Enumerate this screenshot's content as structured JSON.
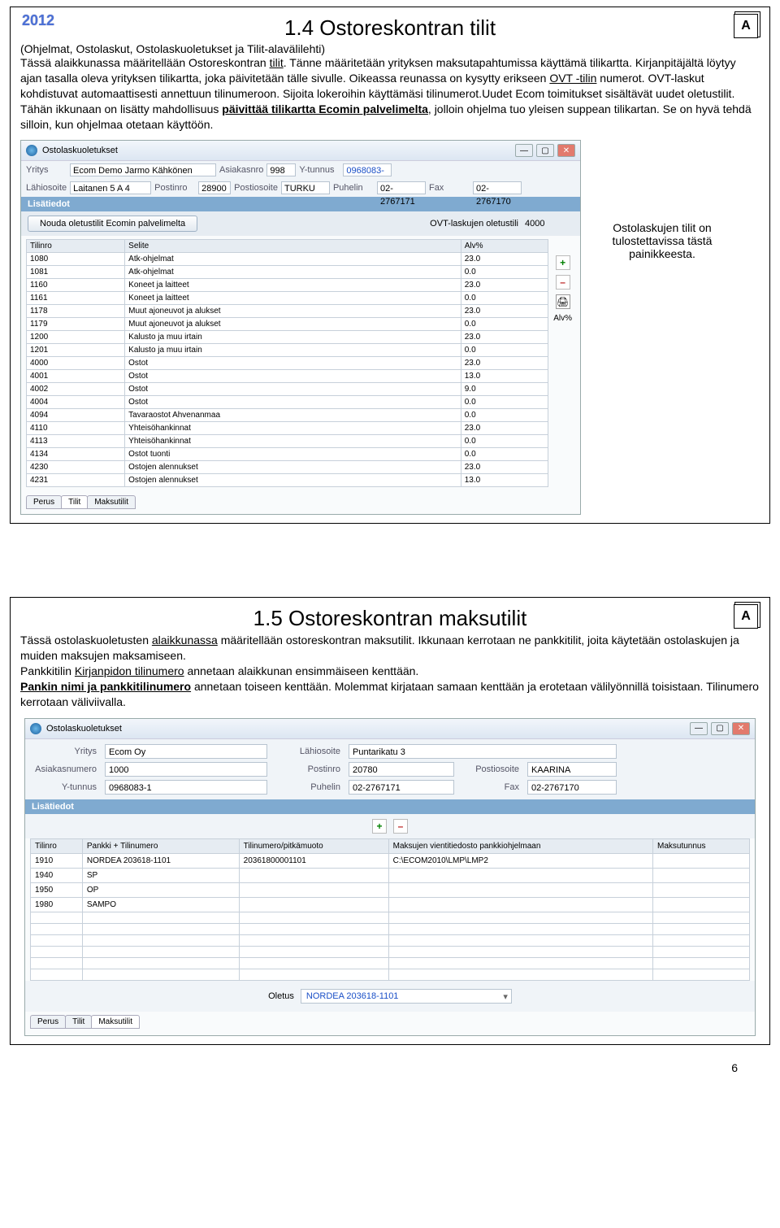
{
  "year": "2012",
  "page_number": "6",
  "section1": {
    "title": "1.4 Ostoreskontran tilit",
    "subtitle": "(Ohjelmat, Ostolaskut, Ostolaskuoletukset ja Tilit-alavälilehti)",
    "paragraph_html": "Tässä alaikkunassa määritellään Ostoreskontran <u>tilit</u>. Tänne  määritetään yrityksen maksutapahtumissa käyttämä tilikartta. Kirjanpitäjältä löytyy ajan tasalla oleva yrityksen tilikartta, joka päivitetään tälle sivulle. Oikeassa reunassa on kysytty erikseen <u>OVT -tilin</u> numerot. OVT-laskut kohdistuvat automaattisesti annettuun tilinumeroon. Sijoita lokeroihin käyttämäsi tilinumerot.Uudet Ecom toimitukset sisältävät uudet oletustilit. Tähän ikkunaan on lisätty mahdollisuus <u><b>päivittää tilikartta Ecomin palvelimelta</b></u>, jolloin ohjelma tuo yleisen suppean tilikartan. Se on hyvä tehdä silloin, kun ohjelmaa otetaan käyttöön.",
    "callout": "Ostolaskujen tilit on tulostettavissa tästä painikkeesta.",
    "window": {
      "title": "Ostolaskuoletukset",
      "row1": {
        "yritys_label": "Yritys",
        "yritys": "Ecom Demo Jarmo Kähkönen",
        "asiakasnro_label": "Asiakasnro",
        "asiakasnro": "998",
        "ytunnus_label": "Y-tunnus",
        "ytunnus": "0968083-"
      },
      "row2": {
        "lahiosoite_label": "Lähiosoite",
        "lahiosoite": "Laitanen 5 A 4",
        "postinro_label": "Postinro",
        "postinro": "28900",
        "postiosoite_label": "Postiosoite",
        "postiosoite": "TURKU",
        "puhelin_label": "Puhelin",
        "puhelin": "02-2767171",
        "fax_label": "Fax",
        "fax": "02-2767170"
      },
      "lisatiedot": "Lisätiedot",
      "btn_nouda": "Nouda oletustilit Ecomin palvelimelta",
      "ovt_label": "OVT-laskujen oletustili",
      "ovt_value": "4000",
      "headers": [
        "Tilinro",
        "Selite",
        "Alv%"
      ],
      "rows": [
        [
          "1080",
          "Atk-ohjelmat",
          "23.0"
        ],
        [
          "1081",
          "Atk-ohjelmat",
          "0.0"
        ],
        [
          "1160",
          "Koneet ja laitteet",
          "23.0"
        ],
        [
          "1161",
          "Koneet ja laitteet",
          "0.0"
        ],
        [
          "1178",
          "Muut ajoneuvot ja alukset",
          "23.0"
        ],
        [
          "1179",
          "Muut ajoneuvot ja alukset",
          "0.0"
        ],
        [
          "1200",
          "Kalusto ja muu irtain",
          "23.0"
        ],
        [
          "1201",
          "Kalusto ja muu irtain",
          "0.0"
        ],
        [
          "4000",
          "Ostot",
          "23.0"
        ],
        [
          "4001",
          "Ostot",
          "13.0"
        ],
        [
          "4002",
          "Ostot",
          "9.0"
        ],
        [
          "4004",
          "Ostot",
          "0.0"
        ],
        [
          "4094",
          "Tavaraostot Ahvenanmaa",
          "0.0"
        ],
        [
          "4110",
          "Yhteisöhankinnat",
          "23.0"
        ],
        [
          "4113",
          "Yhteisöhankinnat",
          "0.0"
        ],
        [
          "4134",
          "Ostot tuonti",
          "0.0"
        ],
        [
          "4230",
          "Ostojen alennukset",
          "23.0"
        ],
        [
          "4231",
          "Ostojen alennukset",
          "13.0"
        ]
      ],
      "alv_label": "Alv%",
      "tabs": [
        "Perus",
        "Tilit",
        "Maksutilit"
      ]
    }
  },
  "section2": {
    "title": "1.5 Ostoreskontran maksutilit",
    "paragraph_html": "Tässä ostolaskuoletusten <u>alaikkunassa</u> määritellään ostoreskontran maksutilit. Ikkunaan kerrotaan ne pankkitilit, joita käytetään ostolaskujen ja muiden maksujen maksamiseen.<br>Pankkitilin <u>Kirjanpidon tilinumero</u> annetaan alaikkunan ensimmäiseen kenttään.<br><u><b>Pankin nimi ja pankkitilinumero</b></u> annetaan toiseen kenttään. Molemmat kirjataan samaan kenttään ja erotetaan välilyönnillä toisistaan. Tilinumero kerrotaan väliviivalla.",
    "window": {
      "title": "Ostolaskuoletukset",
      "form": {
        "yritys_label": "Yritys",
        "yritys": "Ecom Oy",
        "lahiosoite_label": "Lähiosoite",
        "lahiosoite": "Puntarikatu 3",
        "asiakasnumero_label": "Asiakasnumero",
        "asiakasnumero": "1000",
        "postinro_label": "Postinro",
        "postinro": "20780",
        "postiosoite_label": "Postiosoite",
        "postiosoite": "KAARINA",
        "ytunnus_label": "Y-tunnus",
        "ytunnus": "0968083-1",
        "puhelin_label": "Puhelin",
        "puhelin": "02-2767171",
        "fax_label": "Fax",
        "fax": "02-2767170"
      },
      "lisatiedot": "Lisätiedot",
      "headers": [
        "Tilinro",
        "Pankki + Tilinumero",
        "Tilinumero/pitkämuoto",
        "Maksujen vientitiedosto pankkiohjelmaan",
        "Maksutunnus"
      ],
      "rows": [
        [
          "1910",
          "NORDEA 203618-1101",
          "20361800001101",
          "C:\\ECOM2010\\LMP\\LMP2",
          ""
        ],
        [
          "1940",
          "SP",
          "",
          "",
          ""
        ],
        [
          "1950",
          "OP",
          "",
          "",
          ""
        ],
        [
          "1980",
          "SAMPO",
          "",
          "",
          ""
        ]
      ],
      "oletus_label": "Oletus",
      "oletus_value": "NORDEA 203618-1101",
      "tabs": [
        "Perus",
        "Tilit",
        "Maksutilit"
      ]
    }
  }
}
